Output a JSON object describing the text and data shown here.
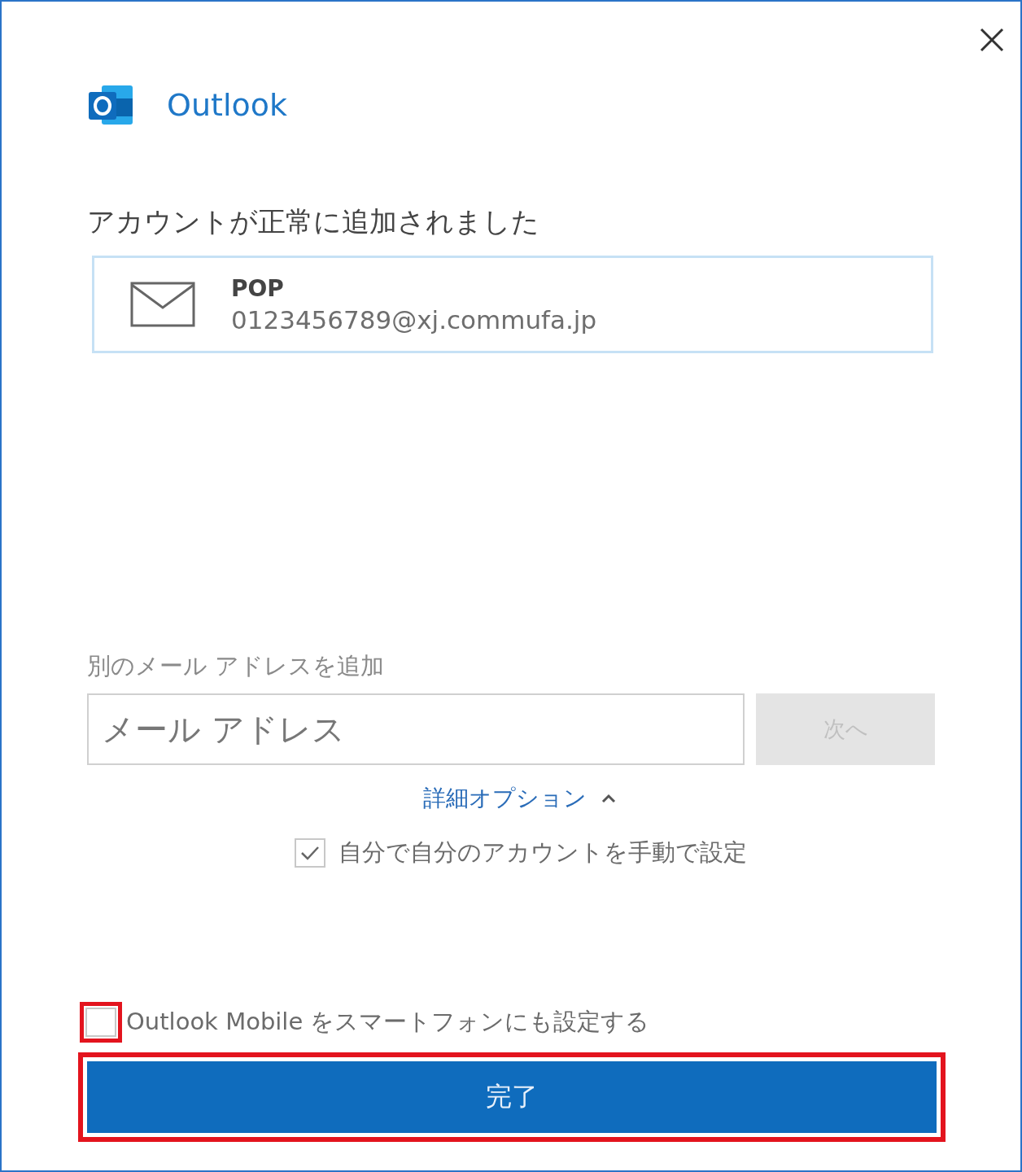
{
  "app": {
    "name": "Outlook"
  },
  "status_heading": "アカウントが正常に追加されました",
  "account": {
    "type": "POP",
    "email": "0123456789@xj.commufa.jp"
  },
  "add_account": {
    "label": "別のメール アドレスを追加",
    "field": {
      "placeholder": "メール アドレス"
    },
    "next_button": {
      "label": "次へ",
      "disabled": true
    }
  },
  "advanced_options": {
    "label": "詳細オプション",
    "expanded": true
  },
  "manual_setup": {
    "label": "自分で自分のアカウントを手動で設定",
    "checked": true
  },
  "mobile_setup": {
    "label": "Outlook Mobile をスマートフォンにも設定する",
    "checked": false,
    "highlighted": true
  },
  "finish_button": {
    "label": "完了",
    "highlighted": true
  }
}
